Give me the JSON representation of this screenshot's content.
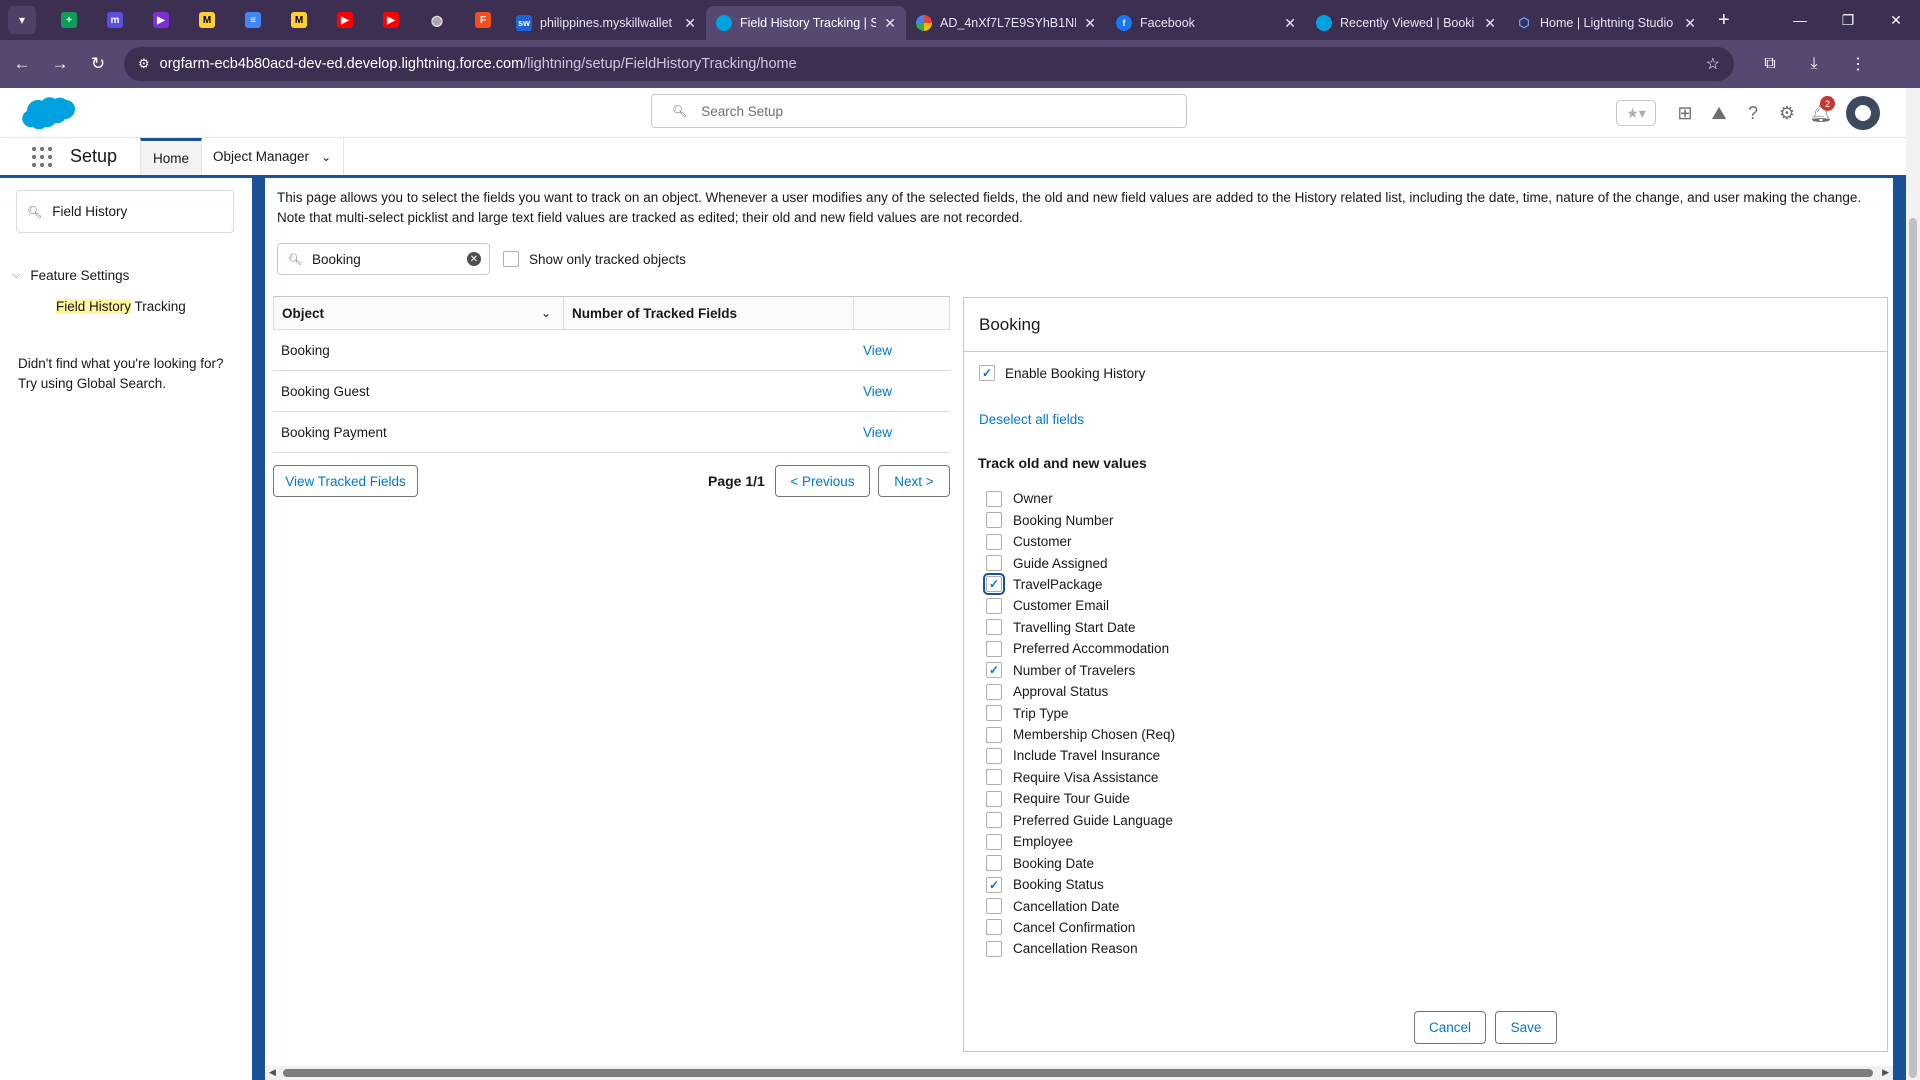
{
  "browser": {
    "tabs": [
      {
        "title": "philippines.myskillwallet",
        "icon": "skillwallet-icon",
        "active": false
      },
      {
        "title": "Field History Tracking | S",
        "icon": "salesforce-cloud-icon",
        "active": true
      },
      {
        "title": "AD_4nXf7L7E9SYhB1NF",
        "icon": "photos-pinwheel-icon",
        "active": false
      },
      {
        "title": "Facebook",
        "icon": "facebook-icon",
        "active": false
      },
      {
        "title": "Recently Viewed | Booki",
        "icon": "salesforce-cloud-icon",
        "active": false
      },
      {
        "title": "Home | Lightning Studio",
        "icon": "lightning-studio-icon",
        "active": false
      }
    ],
    "url_host": "orgfarm-ecb4b80acd-dev-ed.develop.lightning.force.com",
    "url_path": "/lightning/setup/FieldHistoryTracking/home"
  },
  "header": {
    "search_placeholder": "Search Setup",
    "notification_count": "2"
  },
  "nav": {
    "app_name": "Setup",
    "tab_home": "Home",
    "tab_object_manager": "Object Manager"
  },
  "sidebar": {
    "quick_find_value": "Field History",
    "section": "Feature Settings",
    "item_highlight": "Field History",
    "item_rest": " Tracking",
    "not_found_line1": "Didn't find what you're looking for?",
    "not_found_line2": "Try using Global Search."
  },
  "main": {
    "intro": "This page allows you to select the fields you want to track on an object. Whenever a user modifies any of the selected fields, the old and new field values are added to the History related list, including the date, time, nature of the change, and user making the change. Note that multi-select picklist and large text field values are tracked as edited; their old and new field values are not recorded.",
    "object_search_value": "Booking",
    "only_tracked_label": "Show only tracked objects",
    "table": {
      "col_object": "Object",
      "col_tracked": "Number of Tracked Fields",
      "rows": [
        {
          "object": "Booking",
          "tracked": "",
          "action": "View"
        },
        {
          "object": "Booking Guest",
          "tracked": "",
          "action": "View"
        },
        {
          "object": "Booking Payment",
          "tracked": "",
          "action": "View"
        }
      ]
    },
    "view_tracked_label": "View Tracked Fields",
    "page_info": "Page 1/1",
    "prev_label": "< Previous",
    "next_label": "Next >"
  },
  "panel": {
    "title": "Booking",
    "enable_label": "Enable Booking History",
    "enable_checked": true,
    "deselect_label": "Deselect all fields",
    "track_title": "Track old and new values",
    "fields": [
      {
        "label": "Owner",
        "checked": false
      },
      {
        "label": "Booking Number",
        "checked": false
      },
      {
        "label": "Customer",
        "checked": false
      },
      {
        "label": "Guide Assigned",
        "checked": false
      },
      {
        "label": "TravelPackage",
        "checked": true,
        "focused": true
      },
      {
        "label": "Customer Email",
        "checked": false
      },
      {
        "label": "Travelling Start Date",
        "checked": false
      },
      {
        "label": "Preferred Accommodation",
        "checked": false
      },
      {
        "label": "Number of Travelers",
        "checked": true
      },
      {
        "label": "Approval Status",
        "checked": false
      },
      {
        "label": "Trip Type",
        "checked": false
      },
      {
        "label": "Membership Chosen (Req)",
        "checked": false
      },
      {
        "label": "Include Travel Insurance",
        "checked": false
      },
      {
        "label": "Require Visa Assistance",
        "checked": false
      },
      {
        "label": "Require Tour Guide",
        "checked": false
      },
      {
        "label": "Preferred Guide Language",
        "checked": false
      },
      {
        "label": "Employee",
        "checked": false
      },
      {
        "label": "Booking Date",
        "checked": false
      },
      {
        "label": "Booking Status",
        "checked": true
      },
      {
        "label": "Cancellation Date",
        "checked": false
      },
      {
        "label": "Cancel Confirmation",
        "checked": false
      },
      {
        "label": "Cancellation Reason",
        "checked": false
      }
    ],
    "cancel_label": "Cancel",
    "save_label": "Save"
  },
  "colors": {
    "brand_blue": "#1b5297",
    "link_blue": "#0176d3",
    "browser_tab_bar": "#3c2f52",
    "browser_toolbar": "#574872",
    "highlight_yellow": "#fff59d"
  }
}
